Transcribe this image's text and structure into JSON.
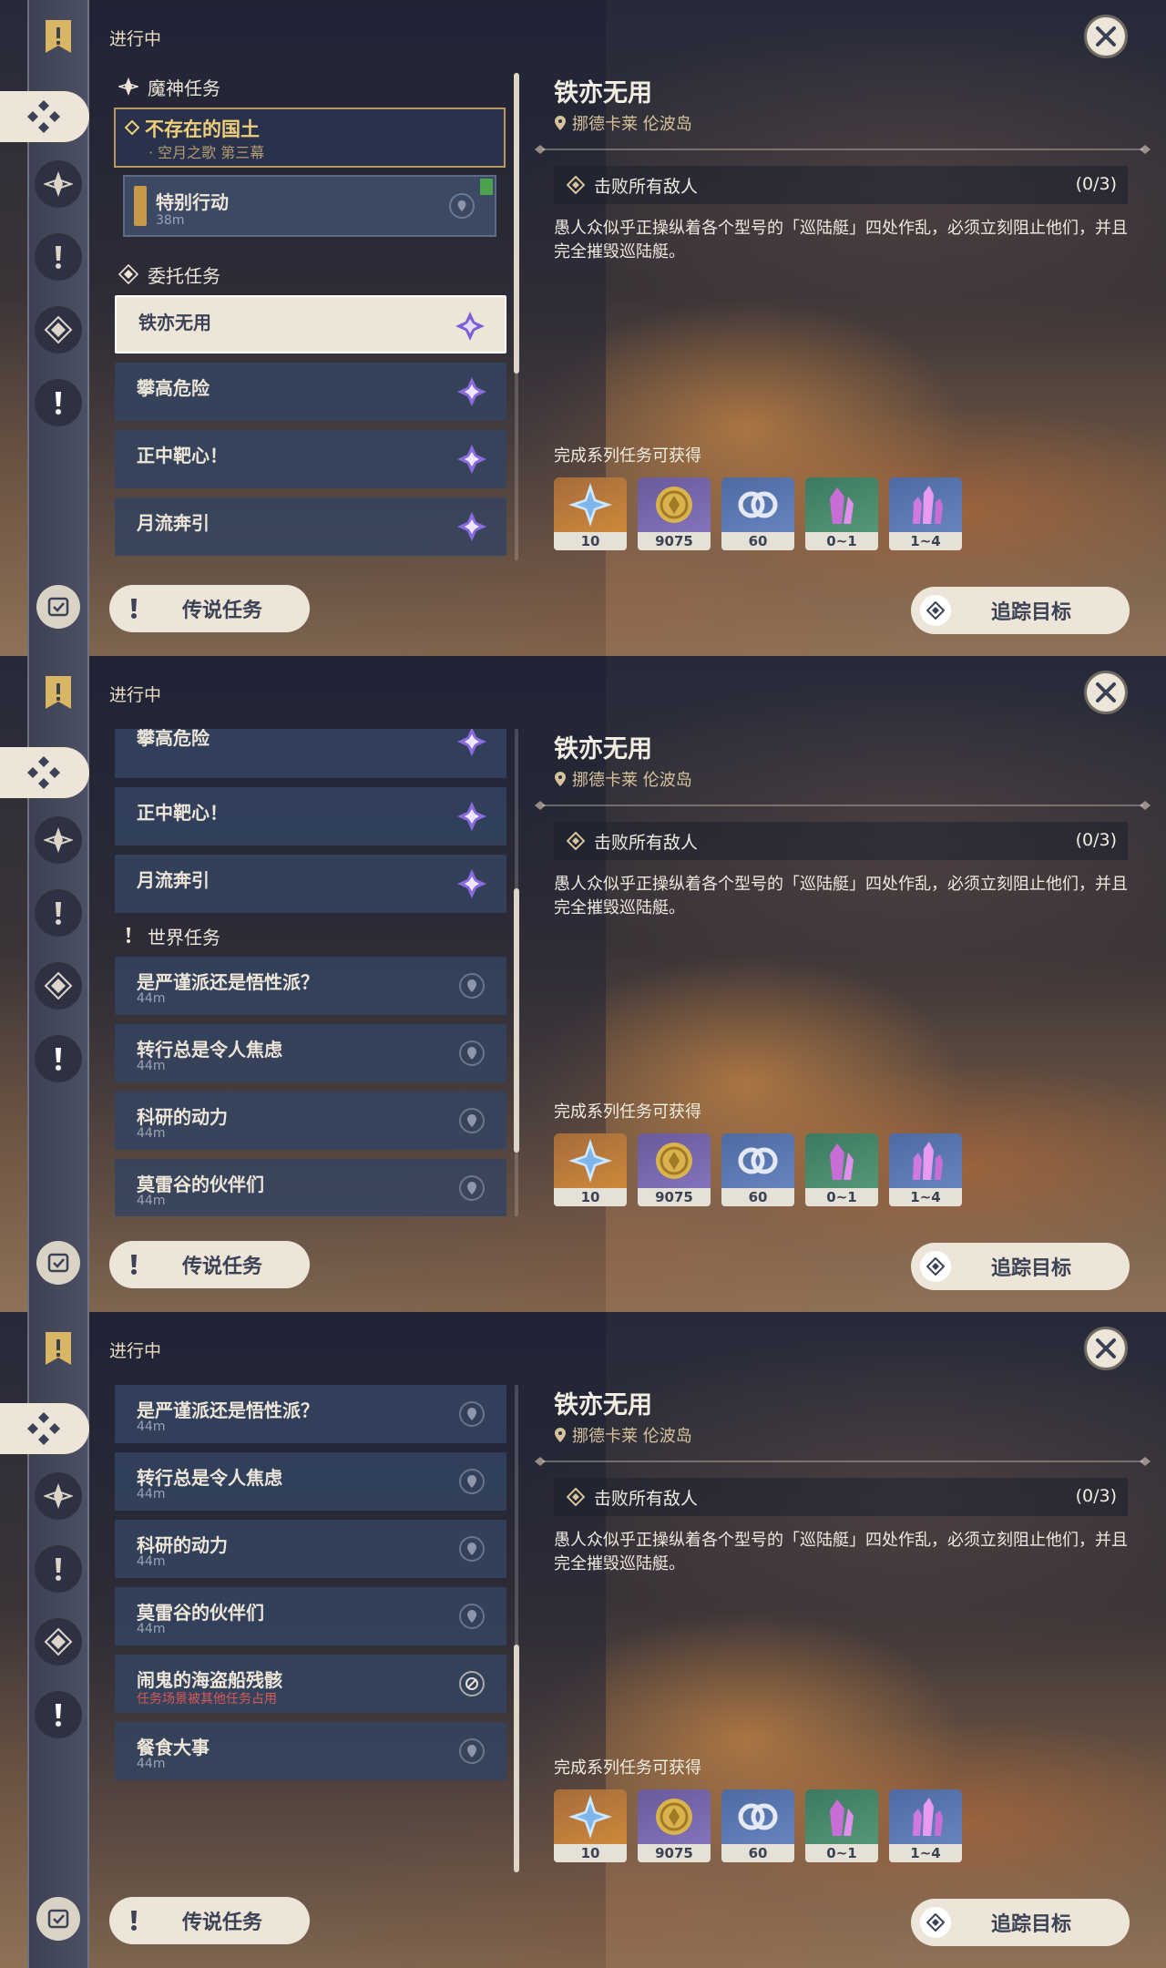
{
  "ui": {
    "in_progress": "进行中",
    "close_icon": "close-icon",
    "legend_button": "传说任务",
    "track_button": "追踪目标"
  },
  "quest": {
    "title": "铁亦无用",
    "location": "挪德卡莱 伦波岛",
    "objective": "击败所有敌人",
    "objective_count": "(0/3)",
    "description": "愚人众似乎正操纵着各个型号的「巡陆艇」四处作乱，必须立刻阻止他们，并且完全摧毁巡陆艇。",
    "rewards_label": "完成系列任务可获得",
    "rewards": [
      {
        "count": "10",
        "icon": "primogem-icon",
        "color": "#d7903a"
      },
      {
        "count": "9075",
        "icon": "mora-icon",
        "color": "#8a78c2"
      },
      {
        "count": "60",
        "icon": "adventure-exp-icon",
        "color": "#6b8ac6"
      },
      {
        "count": "0~1",
        "icon": "crystal-icon",
        "color": "#5c9c7c"
      },
      {
        "count": "1~4",
        "icon": "crystal-cluster-icon",
        "color": "#6b8ac6"
      }
    ]
  },
  "categories": {
    "archon": "魔神任务",
    "commission": "委托任务",
    "world": "世界任务"
  },
  "archon": {
    "title": "不存在的国土",
    "sub": "· 空月之歌 第三幕",
    "child_title": "特别行动",
    "child_dist": "38m"
  },
  "commissions": [
    "铁亦无用",
    "攀高危险",
    "正中靶心！",
    "月流奔引"
  ],
  "world": [
    {
      "title": "是严谨派还是悟性派？",
      "sub": "44m"
    },
    {
      "title": "转行总是令人焦虑",
      "sub": "44m"
    },
    {
      "title": "科研的动力",
      "sub": "44m"
    },
    {
      "title": "莫雷谷的伙伴们",
      "sub": "44m"
    },
    {
      "title": "闹鬼的海盗船残骸",
      "sub": "任务场景被其他任务占用"
    },
    {
      "title": "餐食大事",
      "sub": "44m"
    }
  ],
  "colors": {
    "panel_cream": "#ece5d8",
    "archon_gold": "#f0cf7c",
    "row_blue": "#344460",
    "commission_purple": "#8a6be0"
  }
}
